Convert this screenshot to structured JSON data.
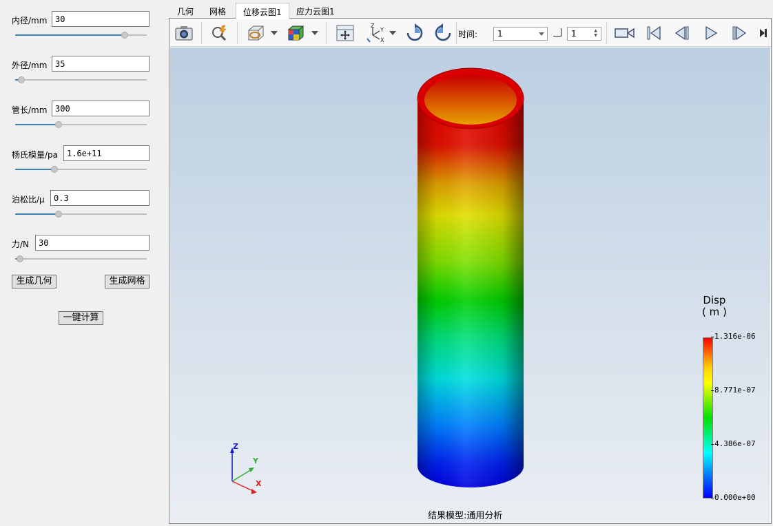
{
  "params": {
    "inner_diameter": {
      "label": "内径/mm",
      "value": "30",
      "slider_fraction": 0.85
    },
    "outer_diameter": {
      "label": "外径/mm",
      "value": "35",
      "slider_fraction": 0.02
    },
    "tube_length": {
      "label": "管长/mm",
      "value": "300",
      "slider_fraction": 0.32
    },
    "youngs_modulus": {
      "label": "杨氏模量/pa",
      "value": "1.6e+11",
      "slider_fraction": 0.29
    },
    "poisson_ratio": {
      "label": "泊松比/μ",
      "value": "0.3",
      "slider_fraction": 0.32
    },
    "force": {
      "label": "力/N",
      "value": "30",
      "slider_fraction": 0.01
    }
  },
  "buttons": {
    "generate_geometry": "生成几何",
    "generate_mesh": "生成网格",
    "one_click_compute": "一键计算"
  },
  "tabs": [
    "几何",
    "网格",
    "位移云图1",
    "应力云图1"
  ],
  "active_tab": "位移云图1",
  "toolbar": {
    "time_label": "时间:",
    "time_value": "1",
    "step_value": "1"
  },
  "viewport": {
    "model_caption": "结果模型:通用分析",
    "axes": {
      "x": "X",
      "y": "Y",
      "z": "Z"
    }
  },
  "legend": {
    "title": "Disp",
    "unit": "( m )",
    "max": "1.316e-06",
    "upper_mid": "8.771e-07",
    "lower_mid": "4.386e-07",
    "min": "0.000e+00"
  },
  "colors": {
    "accent": "#3c7fb1",
    "viewport_top": "#bccfe2",
    "viewport_bottom": "#eaeef3"
  }
}
